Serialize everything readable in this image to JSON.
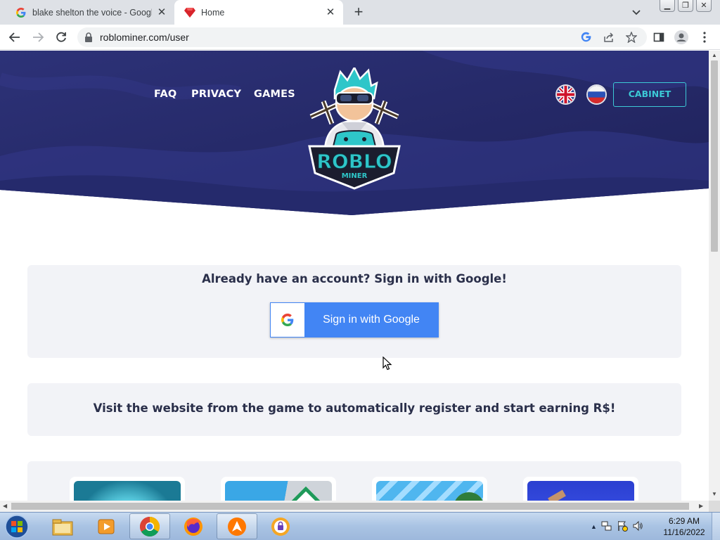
{
  "browser": {
    "tabs": [
      {
        "title": "blake shelton the voice - Google",
        "favicon": "google-g-icon",
        "active": false
      },
      {
        "title": "Home",
        "favicon": "red-gem-icon",
        "active": true
      }
    ],
    "url": "roblominer.com/user"
  },
  "site": {
    "nav": [
      "FAQ",
      "PRIVACY",
      "GAMES"
    ],
    "logo_text": "ROBLO",
    "logo_subtext": "MINER",
    "cabinet_label": "CABINET",
    "languages": [
      "english-flag",
      "russian-flag"
    ],
    "hero_color": "#26296a",
    "accent_color": "#3cc9d6"
  },
  "main": {
    "signin_heading": "Already have an account? Sign in with Google!",
    "signin_button": "Sign in with Google",
    "visit_heading": "Visit the website from the game to automatically register and start earning R$!",
    "game_thumbs": [
      "game-thumb-1",
      "game-thumb-2",
      "game-thumb-3",
      "game-thumb-4"
    ]
  },
  "taskbar": {
    "time": "6:29 AM",
    "date": "11/16/2022",
    "apps": [
      "file-explorer-icon",
      "media-player-icon",
      "chrome-icon",
      "firefox-icon",
      "avast-icon",
      "vpn-icon"
    ]
  }
}
